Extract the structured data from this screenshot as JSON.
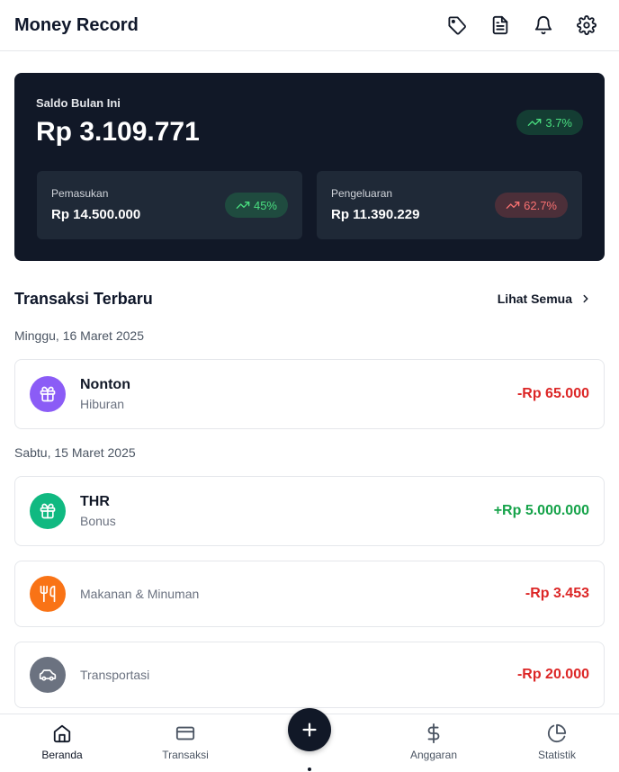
{
  "header": {
    "title": "Money Record"
  },
  "balance": {
    "label": "Saldo Bulan Ini",
    "value": "Rp 3.109.771",
    "change": "3.7%",
    "income": {
      "label": "Pemasukan",
      "value": "Rp 14.500.000",
      "change": "45%"
    },
    "expense": {
      "label": "Pengeluaran",
      "value": "Rp 11.390.229",
      "change": "62.7%"
    }
  },
  "recent": {
    "title": "Transaksi Terbaru",
    "see_all": "Lihat Semua",
    "groups": [
      {
        "date": "Minggu, 16 Maret 2025",
        "items": [
          {
            "name": "Nonton",
            "category": "Hiburan",
            "amount": "-Rp 65.000",
            "icon": "gift-icon",
            "color": "#8b5cf6"
          }
        ]
      },
      {
        "date": "Sabtu, 15 Maret 2025",
        "items": [
          {
            "name": "THR",
            "category": "Bonus",
            "amount": "+Rp 5.000.000",
            "icon": "gift-icon",
            "color": "#10b981"
          },
          {
            "name": "",
            "category": "Makanan & Minuman",
            "amount": "-Rp 3.453",
            "icon": "utensils-icon",
            "color": "#f97316"
          },
          {
            "name": "",
            "category": "Transportasi",
            "amount": "-Rp 20.000",
            "icon": "car-icon",
            "color": "#6b7280"
          }
        ]
      }
    ]
  },
  "nav": {
    "items": [
      {
        "label": "Beranda",
        "icon": "home-icon"
      },
      {
        "label": "Transaksi",
        "icon": "credit-card-icon"
      },
      {
        "label": "Anggaran",
        "icon": "dollar-icon"
      },
      {
        "label": "Statistik",
        "icon": "pie-chart-icon"
      }
    ]
  },
  "colors": {
    "card_bg": "#111827",
    "positive": "#16a34a",
    "negative": "#dc2626"
  }
}
